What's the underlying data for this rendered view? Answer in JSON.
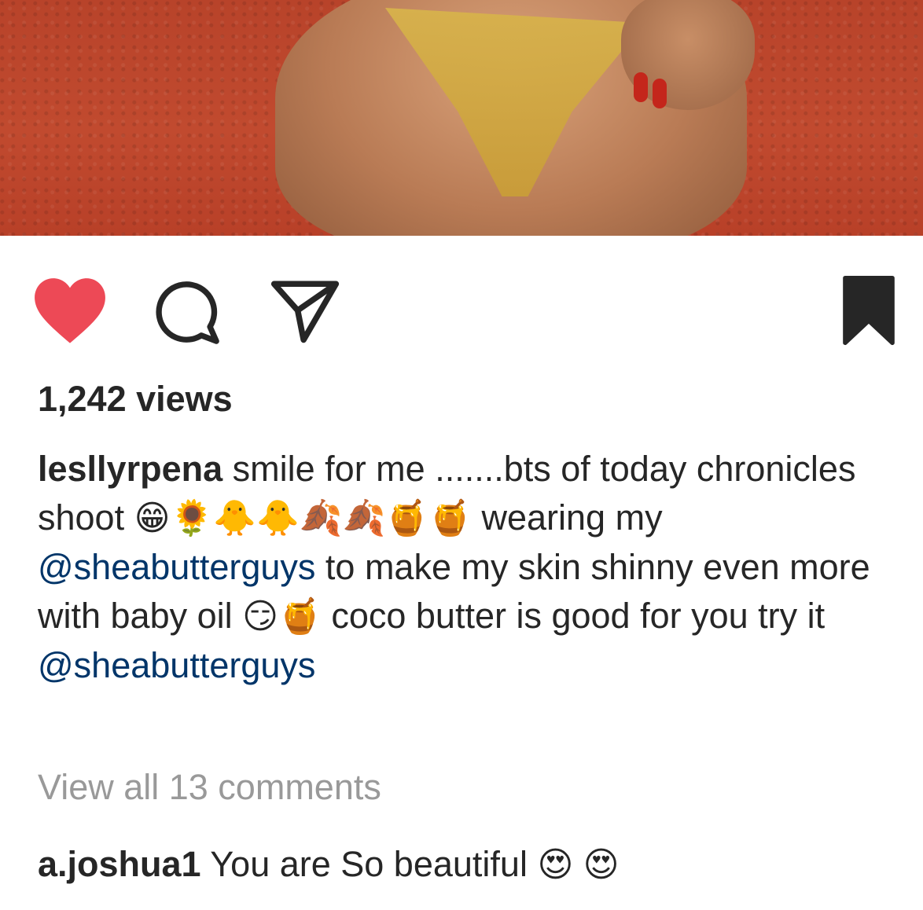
{
  "post": {
    "views": "1,242 views",
    "caption": {
      "username": "lesllyrpena",
      "text_1": "smile for me .......bts of today chronicles shoot",
      "emojis_1": "😁🌻🐥🐥🍂🍂🍯🍯",
      "text_2": "wearing my",
      "mention_1": "@sheabutterguys",
      "text_3": "to make my skin shinny even more with baby oil",
      "emojis_2": "😏🍯",
      "text_4": "coco butter is good for you try it",
      "mention_2": "@sheabutterguys"
    },
    "view_all_comments": "View all 13 comments",
    "comment": {
      "username": "a.joshua1",
      "text": "You are So beautiful",
      "emojis": "😍 😍"
    }
  },
  "icons": {
    "like": "heart-icon",
    "comment": "comment-icon",
    "share": "share-icon",
    "save": "bookmark-icon"
  },
  "colors": {
    "heart": "#ed4956",
    "text": "#262626",
    "mention": "#003569",
    "muted": "#999999"
  }
}
